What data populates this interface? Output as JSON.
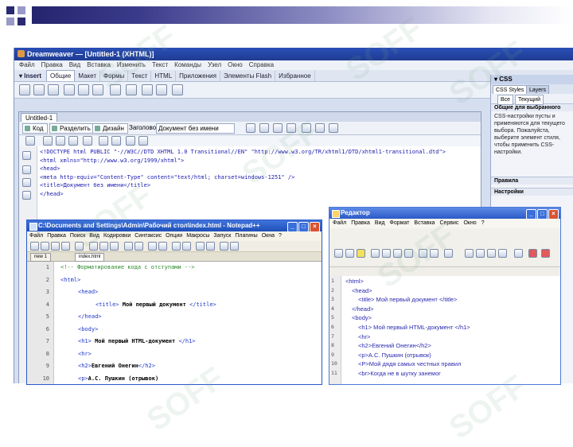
{
  "watermark": "SOFF",
  "app": {
    "title": "Dreamweaver — [Untitled-1 (XHTML)]",
    "menu": [
      "Файл",
      "Правка",
      "Вид",
      "Вставка",
      "Изменить",
      "Текст",
      "Команды",
      "Узел",
      "Окно",
      "Справка"
    ],
    "insert_label": "▾ Insert",
    "insert_tabs": [
      "Общие",
      "Макет",
      "Формы",
      "Текст",
      "HTML",
      "Приложения",
      "Элементы Flash",
      "Избранное"
    ],
    "document": {
      "tab": "Untitled-1",
      "view_buttons": [
        "Код",
        "Разделить",
        "Дизайн"
      ],
      "title_label": "Заголовок:",
      "title_value": "Документ без имени",
      "code_lines": [
        "<!DOCTYPE html PUBLIC \"-//W3C//DTD XHTML 1.0 Transitional//EN\" \"http://www.w3.org/TR/xhtml1/DTD/xhtml1-transitional.dtd\">",
        "<html xmlns=\"http://www.w3.org/1999/xhtml\">",
        "<head>",
        "<meta http-equiv=\"Content-Type\" content=\"text/html; charset=windows-1251\" />",
        "<title>Документ без имени</title>",
        "</head>"
      ]
    },
    "right_panel": {
      "header": "▾ CSS",
      "tabs": [
        "CSS Styles",
        "Layers"
      ],
      "subtabs": [
        "Все",
        "Текущий"
      ],
      "section1": "Общие для выбранного",
      "text1": "CSS-настройки пусты и применяются для текущего выбора. Пожалуйста, выберите элемент стиля, чтобы применить CSS-настройки.",
      "section2": "Правила",
      "section3": "Настройки"
    }
  },
  "notepad": {
    "title": "C:\\Documents and Settings\\Admin\\Рабочий стол\\index.html - Notepad++",
    "menu": [
      "Файл",
      "Правка",
      "Поиск",
      "Вид",
      "Кодировки",
      "Синтаксис",
      "Опции",
      "Макросы",
      "Запуск",
      "Плагины",
      "Окна",
      "?"
    ],
    "tabs": [
      "new 1",
      "index.html"
    ],
    "lines": [
      {
        "n": "1",
        "parts": [
          {
            "t": "<!-- Форматирование кода с отступами -->",
            "c": "t-com"
          }
        ],
        "indent": 0
      },
      {
        "n": "2",
        "parts": [
          {
            "t": "<html>",
            "c": "t-tag"
          }
        ],
        "indent": 0
      },
      {
        "n": "3",
        "parts": [
          {
            "t": "<head>",
            "c": "t-tag"
          }
        ],
        "indent": 1
      },
      {
        "n": "4",
        "parts": [
          {
            "t": "<title>",
            "c": "t-tag"
          },
          {
            "t": " Мой первый документ ",
            "c": "t-txt"
          },
          {
            "t": "</title>",
            "c": "t-tag"
          }
        ],
        "indent": 2
      },
      {
        "n": "5",
        "parts": [
          {
            "t": "</head>",
            "c": "t-tag"
          }
        ],
        "indent": 1
      },
      {
        "n": "6",
        "parts": [
          {
            "t": "<body>",
            "c": "t-tag"
          }
        ],
        "indent": 1
      },
      {
        "n": "7",
        "parts": [
          {
            "t": "<h1>",
            "c": "t-tag"
          },
          {
            "t": " Мой первый HTML-документ ",
            "c": "t-txt"
          },
          {
            "t": "</h1>",
            "c": "t-tag"
          }
        ],
        "indent": 1
      },
      {
        "n": "8",
        "parts": [
          {
            "t": "<hr>",
            "c": "t-tag"
          }
        ],
        "indent": 1
      },
      {
        "n": "9",
        "parts": [
          {
            "t": "<h2>",
            "c": "t-tag"
          },
          {
            "t": "Евгений Онегин",
            "c": "t-txt"
          },
          {
            "t": "</h2>",
            "c": "t-tag"
          }
        ],
        "indent": 1
      },
      {
        "n": "10",
        "parts": [
          {
            "t": "<p>",
            "c": "t-tag"
          },
          {
            "t": "А.С. Пушкин (отрывок)",
            "c": "t-txt"
          }
        ],
        "indent": 1
      }
    ]
  },
  "editor2": {
    "title": "Редактор",
    "menu": [
      "Файл",
      "Правка",
      "Вид",
      "Формат",
      "Вставка",
      "Сервис",
      "Окно",
      "?"
    ],
    "lines": [
      {
        "n": "1",
        "t": "<html>",
        "indent": 0
      },
      {
        "n": "2",
        "t": "<head>",
        "indent": 1
      },
      {
        "n": "3",
        "t": "<title> Мой первый документ </title>",
        "indent": 2
      },
      {
        "n": "4",
        "t": "</head>",
        "indent": 1
      },
      {
        "n": "5",
        "t": "<body>",
        "indent": 1
      },
      {
        "n": "6",
        "t": "<h1> Мой первый HTML-документ </h1>",
        "indent": 2
      },
      {
        "n": "7",
        "t": "<hr>",
        "indent": 2
      },
      {
        "n": "8",
        "t": "<h2>Евгений Онегин</h2>",
        "indent": 2
      },
      {
        "n": "9",
        "t": "<p>А.С. Пушкин (отрывок)",
        "indent": 2
      },
      {
        "n": "10",
        "t": "<P>Мой дядя самых честных правил",
        "indent": 2
      },
      {
        "n": "11",
        "t": "<br>Когда не в шутку занемог",
        "indent": 2
      }
    ]
  }
}
